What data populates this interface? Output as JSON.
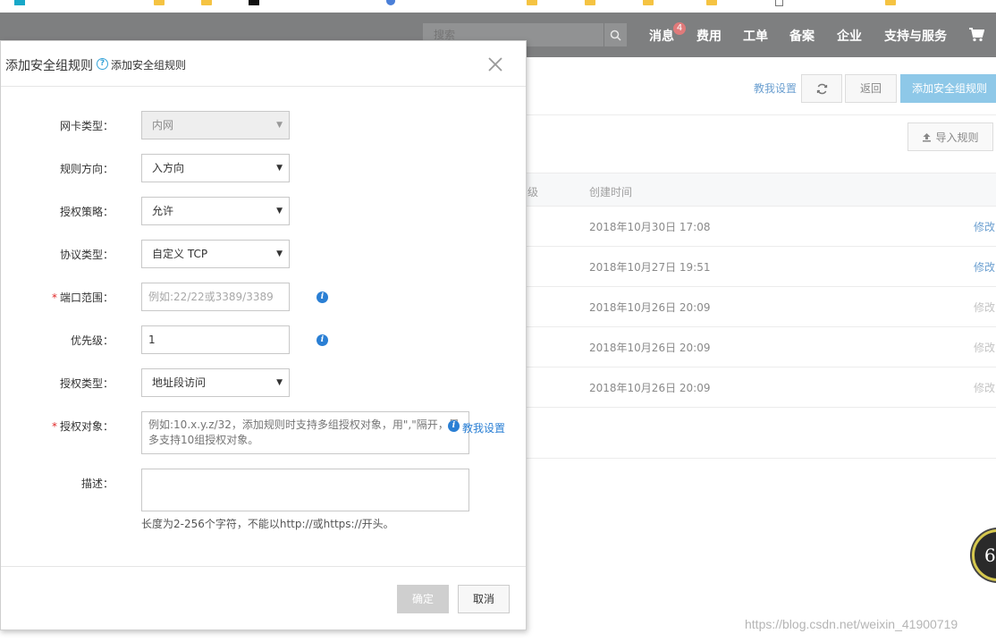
{
  "colors": {
    "nav_bg": "#7e7f80",
    "accent": "#2a7fd4",
    "primary_button": "#8ec8e8",
    "required": "#e02828",
    "disabled_button": "#cfcfcf"
  },
  "topnav": {
    "search_placeholder": "搜索",
    "items": [
      "消息",
      "费用",
      "工单",
      "备案",
      "企业",
      "支持与服务"
    ],
    "message_badge": "4"
  },
  "page": {
    "help_link": "教我设置",
    "back_button": "返回",
    "add_button": "添加安全组规则",
    "import_button": "导入规则",
    "table": {
      "col_partial": "级",
      "col_created": "创建时间",
      "rows": [
        {
          "created": "2018年10月30日 17:08",
          "edit": "修改",
          "edit_enabled": true
        },
        {
          "created": "2018年10月27日 19:51",
          "edit": "修改",
          "edit_enabled": true
        },
        {
          "created": "2018年10月26日 20:09",
          "edit": "修改",
          "edit_enabled": false
        },
        {
          "created": "2018年10月26日 20:09",
          "edit": "修改",
          "edit_enabled": false
        },
        {
          "created": "2018年10月26日 20:09",
          "edit": "修改",
          "edit_enabled": false
        }
      ]
    },
    "floating_badge": "6",
    "watermark": "https://blog.csdn.net/weixin_41900719"
  },
  "modal": {
    "title": "添加安全组规则",
    "subtitle": "添加安全组规则",
    "fields": {
      "nic_type": {
        "label": "网卡类型：",
        "value": "内网"
      },
      "direction": {
        "label": "规则方向：",
        "value": "入方向"
      },
      "policy": {
        "label": "授权策略：",
        "value": "允许"
      },
      "protocol": {
        "label": "协议类型：",
        "value": "自定义 TCP"
      },
      "port_range": {
        "label": "端口范围：",
        "placeholder": "例如:22/22或3389/3389"
      },
      "priority": {
        "label": "优先级：",
        "value": "1"
      },
      "auth_type": {
        "label": "授权类型：",
        "value": "地址段访问"
      },
      "auth_object": {
        "label": "授权对象：",
        "placeholder": "例如:10.x.y.z/32，添加规则时支持多组授权对象，用\",\"隔开，最多支持10组授权对象。",
        "help_link": "教我设置"
      },
      "description": {
        "label": "描述：",
        "hint": "长度为2-256个字符，不能以http://或https://开头。"
      }
    },
    "ok_button": "确定",
    "cancel_button": "取消"
  }
}
